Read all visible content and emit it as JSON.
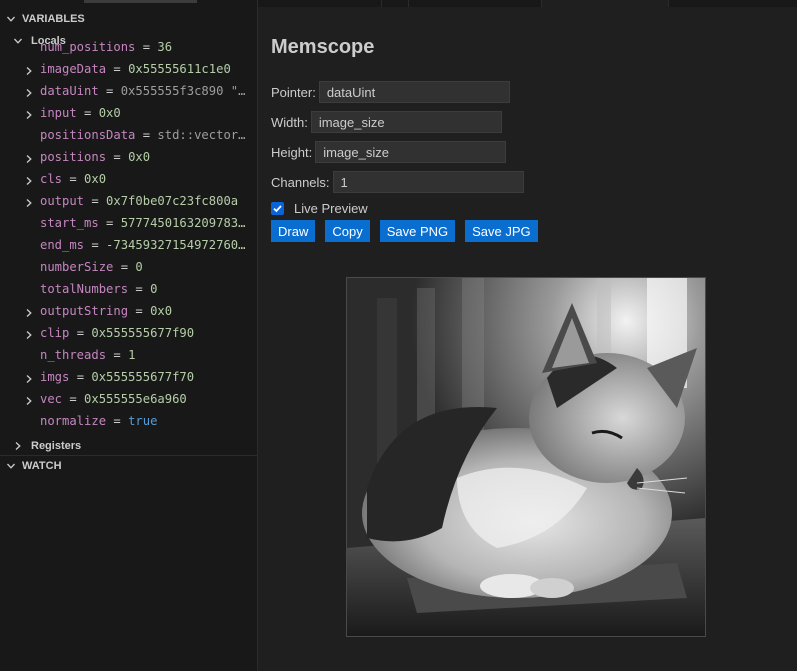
{
  "sidebar": {
    "variables_header": "VARIABLES",
    "locals_header": "Locals",
    "registers_header": "Registers",
    "watch_header": "WATCH",
    "partial_row": {
      "name": "num_positions",
      "value": "36"
    },
    "variables": [
      {
        "name": "imageData",
        "value": "0x55555611c1e0",
        "expandable": true,
        "kind": "num"
      },
      {
        "name": "dataUint",
        "value": "0x555555f3c890 \"…",
        "expandable": true,
        "kind": "str"
      },
      {
        "name": "input",
        "value": "0x0",
        "expandable": true,
        "kind": "num"
      },
      {
        "name": "positionsData",
        "value": "std::vector…",
        "expandable": false,
        "kind": "str"
      },
      {
        "name": "positions",
        "value": "0x0",
        "expandable": true,
        "kind": "num"
      },
      {
        "name": "cls",
        "value": "0x0",
        "expandable": true,
        "kind": "num"
      },
      {
        "name": "output",
        "value": "0x7f0be07c23fc800a",
        "expandable": true,
        "kind": "num"
      },
      {
        "name": "start_ms",
        "value": "5777450163209783…",
        "expandable": false,
        "kind": "num"
      },
      {
        "name": "end_ms",
        "value": "-73459327154972760…",
        "expandable": false,
        "kind": "num"
      },
      {
        "name": "numberSize",
        "value": "0",
        "expandable": false,
        "kind": "num"
      },
      {
        "name": "totalNumbers",
        "value": "0",
        "expandable": false,
        "kind": "num"
      },
      {
        "name": "outputString",
        "value": "0x0",
        "expandable": true,
        "kind": "num"
      },
      {
        "name": "clip",
        "value": "0x555555677f90",
        "expandable": true,
        "kind": "num"
      },
      {
        "name": "n_threads",
        "value": "1",
        "expandable": false,
        "kind": "num"
      },
      {
        "name": "imgs",
        "value": "0x555555677f70",
        "expandable": true,
        "kind": "num"
      },
      {
        "name": "vec",
        "value": "0x555555e6a960",
        "expandable": true,
        "kind": "num"
      },
      {
        "name": "normalize",
        "value": "true",
        "expandable": false,
        "kind": "kw"
      }
    ]
  },
  "memscope": {
    "title": "Memscope",
    "pointer_label": "Pointer:",
    "pointer_value": "dataUint",
    "width_label": "Width:",
    "width_value": "image_size",
    "height_label": "Height:",
    "height_value": "image_size",
    "channels_label": "Channels:",
    "channels_value": "1",
    "live_preview_label": "Live Preview",
    "live_preview_checked": true,
    "buttons": {
      "draw": "Draw",
      "copy": "Copy",
      "save_png": "Save PNG",
      "save_jpg": "Save JPG"
    },
    "preview_image": "grayscale-cat-photo"
  },
  "colors": {
    "var_name": "#c586c0",
    "var_value": "#b5cea8",
    "keyword": "#569cd6",
    "button": "#0a6ed1",
    "checkbox": "#0a64d8"
  }
}
